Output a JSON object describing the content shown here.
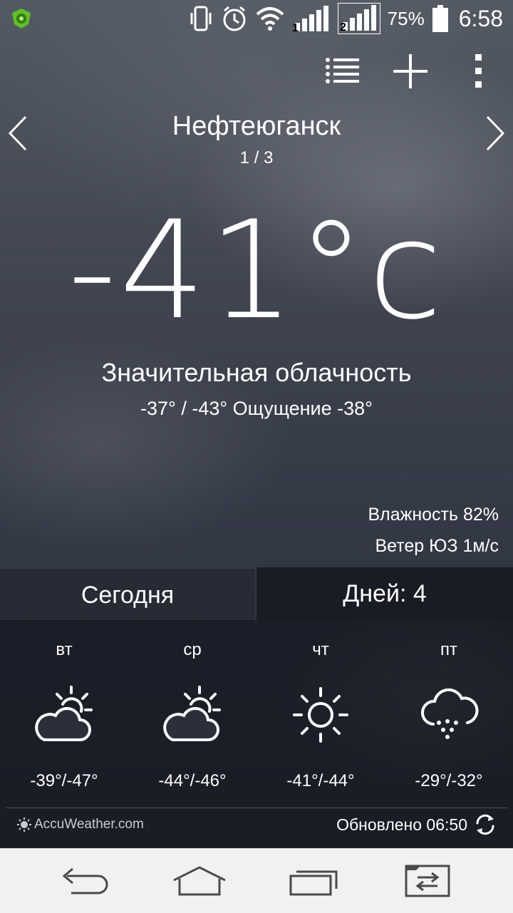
{
  "status_bar": {
    "battery_text": "75%",
    "time": "6:58",
    "sim1": "1",
    "sim2": "2"
  },
  "location": {
    "city": "Нефтеюганск",
    "page": "1 / 3"
  },
  "current": {
    "temperature": "-41°c",
    "condition": "Значительная облачность",
    "hilo_feel": "-37° / -43° Ощущение -38°",
    "humidity": "Влажность 82%",
    "wind": "Ветер ЮЗ 1м/с"
  },
  "tabs": {
    "today": "Сегодня",
    "days": "Дней: 4"
  },
  "forecast": [
    {
      "day": "вт",
      "temp": "-39°/-47°",
      "icon": "partly-cloudy-icon"
    },
    {
      "day": "ср",
      "temp": "-44°/-46°",
      "icon": "partly-cloudy-icon"
    },
    {
      "day": "чт",
      "temp": "-41°/-44°",
      "icon": "sunny-icon"
    },
    {
      "day": "пт",
      "temp": "-29°/-32°",
      "icon": "snow-icon"
    }
  ],
  "footer": {
    "provider": "AccuWeather.com",
    "updated": "Обновлено 06:50"
  }
}
